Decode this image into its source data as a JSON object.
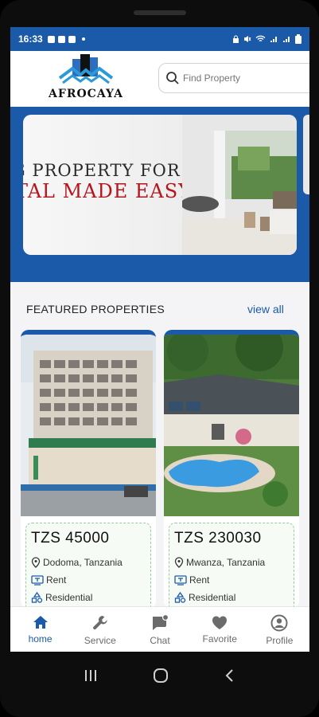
{
  "status_bar": {
    "time": "16:33"
  },
  "brand": {
    "name": "AFROCAYA",
    "primary_color": "#1b5aa8"
  },
  "search": {
    "placeholder": "Find Property"
  },
  "banner": {
    "line1": "G PROPERTY FOR",
    "line2": "TAL MADE EASY"
  },
  "featured": {
    "title": "FEATURED PROPERTIES",
    "view_all": "view all",
    "items": [
      {
        "price": "TZS 45000",
        "location": "Dodoma, Tanzania",
        "purpose": "Rent",
        "category": "Residential",
        "image": "hotel-building"
      },
      {
        "price": "TZS 230030",
        "location": "Mwanza, Tanzania",
        "purpose": "Rent",
        "category": "Residential",
        "image": "house-with-pool"
      }
    ]
  },
  "bottom_nav": {
    "items": [
      {
        "label": "home",
        "icon": "home-icon",
        "active": true
      },
      {
        "label": "Service",
        "icon": "wrench-icon",
        "active": false
      },
      {
        "label": "Chat",
        "icon": "chat-icon",
        "active": false
      },
      {
        "label": "Favorite",
        "icon": "heart-icon",
        "active": false
      },
      {
        "label": "Profile",
        "icon": "profile-icon",
        "active": false
      }
    ]
  }
}
